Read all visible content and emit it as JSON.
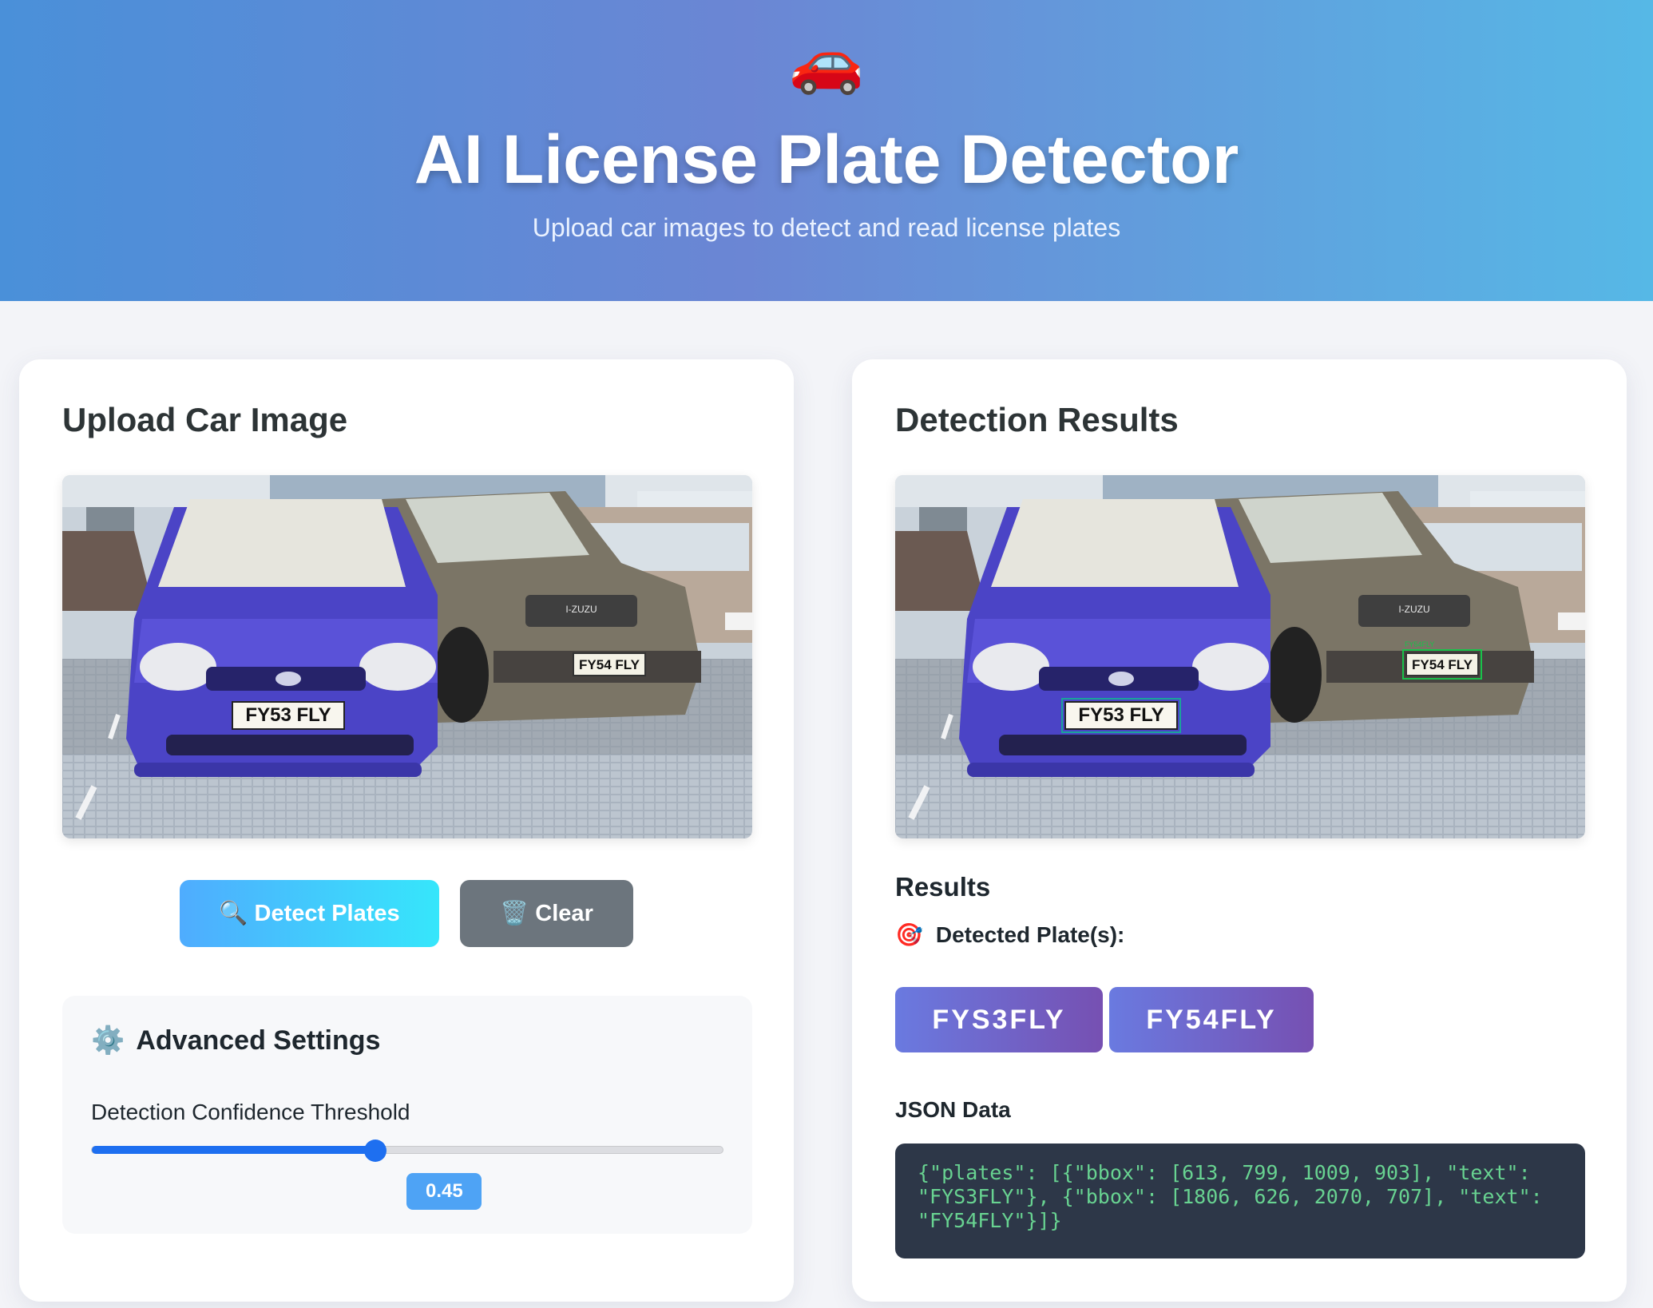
{
  "header": {
    "emoji": "🚗",
    "title": "AI License Plate Detector",
    "subtitle": "Upload car images to detect and read license plates"
  },
  "upload": {
    "title": "Upload Car Image",
    "image_plates": [
      "FY53 FLY",
      "FY54 FLY"
    ],
    "detect_button": "🔍 Detect Plates",
    "clear_button": "🗑️ Clear"
  },
  "settings": {
    "icon": "⚙️",
    "title": "Advanced Settings",
    "threshold_label": "Detection Confidence Threshold",
    "threshold_value": "0.45",
    "threshold_fraction": 0.45
  },
  "results": {
    "title": "Detection Results",
    "subtitle": "Results",
    "detected_icon": "🎯",
    "detected_label": "Detected Plate(s):",
    "plates": [
      "FYS3FLY",
      "FY54FLY"
    ],
    "box_label": "FY54FLY",
    "json_title": "JSON Data",
    "json_text": "{\"plates\": [{\"bbox\": [613, 799, 1009, 903], \"text\": \"FYS3FLY\"}, {\"bbox\": [1806, 626, 2070, 707], \"text\": \"FY54FLY\"}]}"
  },
  "colors": {
    "accent_blue": "#1e6ff0",
    "badge_gradient_start": "#6a7ae0",
    "badge_gradient_end": "#7650b2",
    "json_text": "#68d391"
  }
}
